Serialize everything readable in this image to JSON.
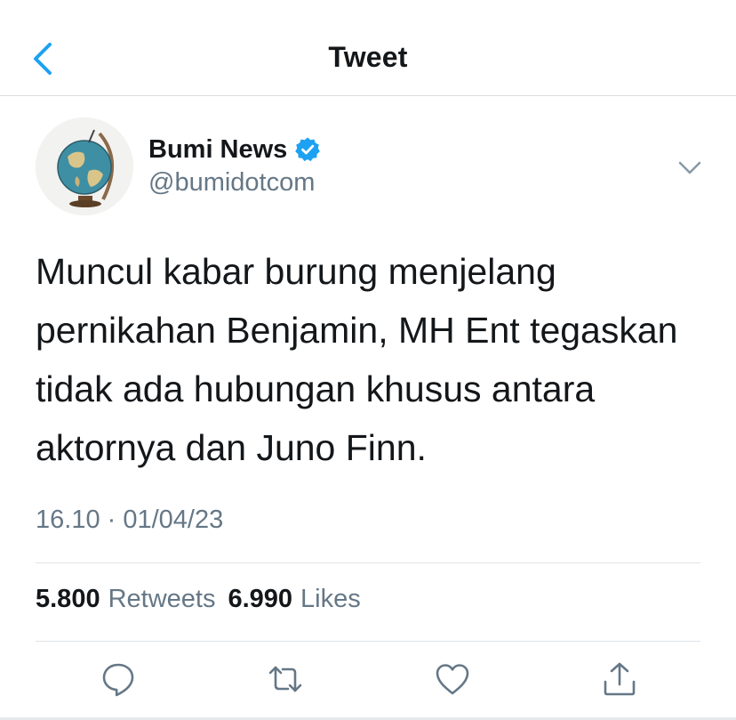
{
  "header": {
    "title": "Tweet",
    "back_icon": "chevron-left-icon"
  },
  "tweet": {
    "display_name": "Bumi News",
    "handle": "@bumidotcom",
    "verified": true,
    "text": "Muncul kabar burung menjelang pernikahan Benjamin, MH Ent tegaskan tidak ada hubungan khusus antara aktornya dan Juno Finn.",
    "timestamp": "16.10 · 01/04/23"
  },
  "stats": {
    "retweets_count": "5.800",
    "retweets_label": "Retweets",
    "likes_count": "6.990",
    "likes_label": "Likes"
  },
  "actions": [
    "reply-icon",
    "retweet-icon",
    "like-icon",
    "share-icon"
  ],
  "colors": {
    "accent": "#1da1f2",
    "text": "#14171a",
    "secondary": "#657786",
    "divider": "#dfe3e6"
  }
}
